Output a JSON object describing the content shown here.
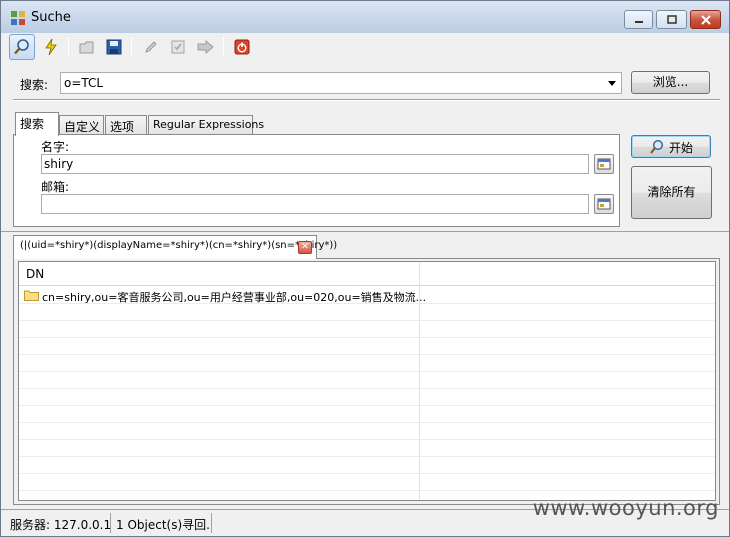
{
  "window": {
    "title": "Suche"
  },
  "search": {
    "label": "搜索:",
    "base_value": "o=TCL",
    "browse_label": "浏览..."
  },
  "tabs": [
    {
      "label": "搜索"
    },
    {
      "label": "自定义"
    },
    {
      "label": "选项"
    },
    {
      "label": "Regular Expressions"
    }
  ],
  "form": {
    "name_label": "名字:",
    "name_value": "shiry",
    "email_label": "邮箱:",
    "email_value": ""
  },
  "actions": {
    "start_label": "开始",
    "clear_label": "清除所有"
  },
  "result": {
    "tab_label": "(|(uid=*shiry*)(displayName=*shiry*)(cn=*shiry*)(sn=*shiry*))",
    "columns": [
      "DN",
      ""
    ],
    "rows": [
      "cn=shiry,ou=客音服务公司,ou=用户经营事业部,ou=020,ou=销售及物流..."
    ]
  },
  "status": {
    "server": "服务器: 127.0.0.1",
    "count": "1 Object(s)寻回."
  },
  "watermark": "www.wooyun.org"
}
